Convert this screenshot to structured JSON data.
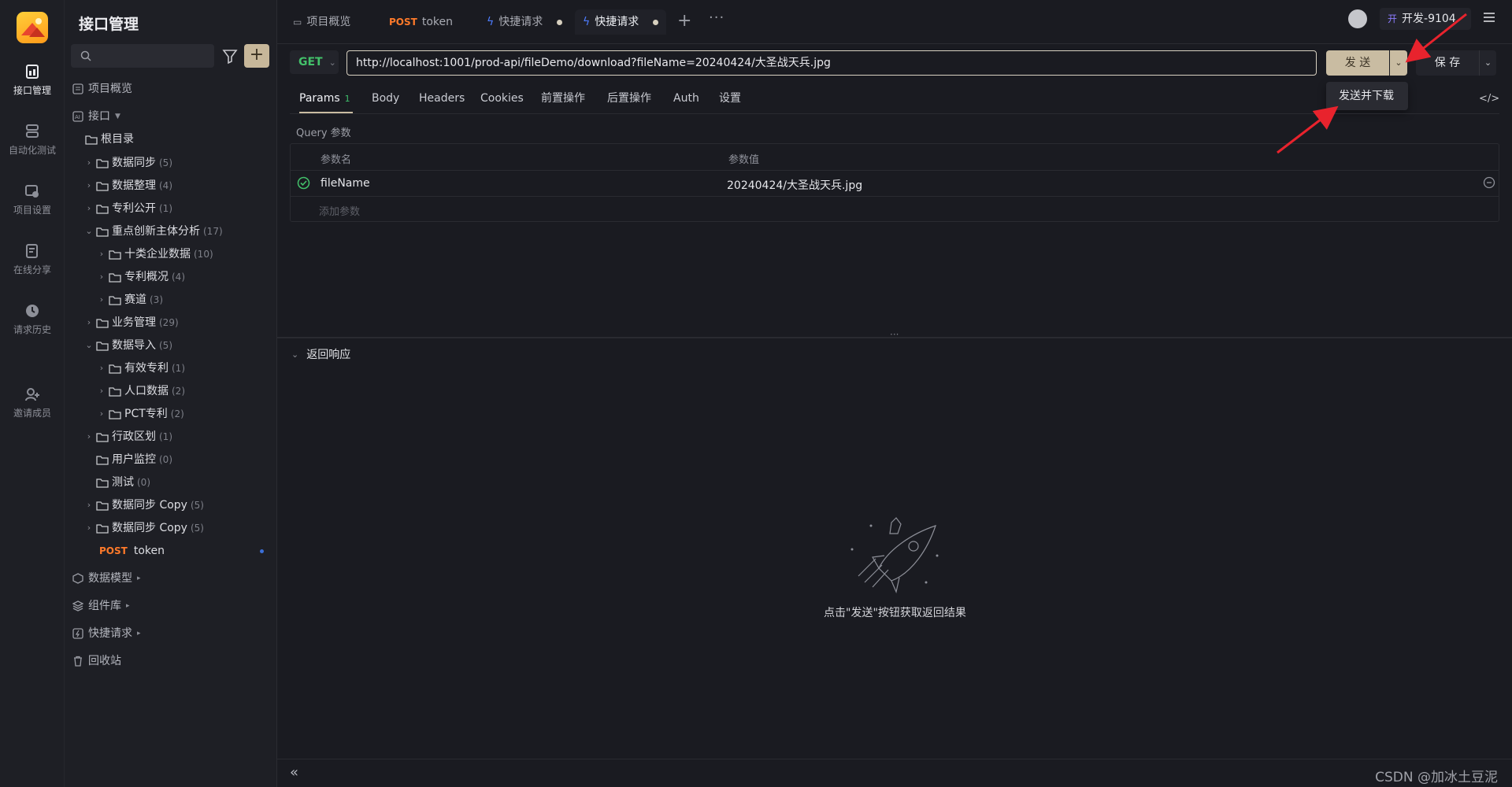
{
  "rail": {
    "items": [
      {
        "label": "接口管理",
        "icon": "api-manage-icon"
      },
      {
        "label": "自动化测试",
        "icon": "auto-test-icon"
      },
      {
        "label": "项目设置",
        "icon": "project-settings-icon"
      },
      {
        "label": "在线分享",
        "icon": "share-icon"
      },
      {
        "label": "请求历史",
        "icon": "history-icon"
      },
      {
        "label": "邀请成员",
        "icon": "invite-member-icon"
      }
    ]
  },
  "sidebar": {
    "title": "接口管理",
    "search_placeholder": "",
    "nav": {
      "overview": "项目概览",
      "api": "接口",
      "data_model": "数据模型",
      "components": "组件库",
      "quick_request": "快捷请求",
      "recycle": "回收站"
    },
    "tree": [
      {
        "label": "根目录",
        "count": ""
      },
      {
        "label": "数据同步",
        "count": "(5)"
      },
      {
        "label": "数据整理",
        "count": "(4)"
      },
      {
        "label": "专利公开",
        "count": "(1)"
      },
      {
        "label": "重点创新主体分析",
        "count": "(17)"
      },
      {
        "label": "十类企业数据",
        "count": "(10)"
      },
      {
        "label": "专利概况",
        "count": "(4)"
      },
      {
        "label": "赛道",
        "count": "(3)"
      },
      {
        "label": "业务管理",
        "count": "(29)"
      },
      {
        "label": "数据导入",
        "count": "(5)"
      },
      {
        "label": "有效专利",
        "count": "(1)"
      },
      {
        "label": "人口数据",
        "count": "(2)"
      },
      {
        "label": "PCT专利",
        "count": "(2)"
      },
      {
        "label": "行政区划",
        "count": "(1)"
      },
      {
        "label": "用户监控",
        "count": "(0)"
      },
      {
        "label": "测试",
        "count": "(0)"
      },
      {
        "label": "数据同步 Copy",
        "count": "(5)"
      },
      {
        "label": "数据同步 Copy",
        "count": "(5)"
      }
    ],
    "token_item": {
      "method": "POST",
      "label": "token"
    }
  },
  "tabs": [
    {
      "label": "项目概览",
      "method": ""
    },
    {
      "label": "token",
      "method": "POST"
    },
    {
      "label": "快捷请求",
      "method": ""
    },
    {
      "label": "快捷请求",
      "method": ""
    }
  ],
  "topbar": {
    "env_tag": "开",
    "env_name": "开发-9104"
  },
  "request": {
    "method": "GET",
    "url": "http://localhost:1001/prod-api/fileDemo/download?fileName=20240424/大圣战天兵.jpg",
    "send_label": "发 送",
    "save_label": "保 存",
    "dropdown_item": "发送并下载"
  },
  "subtabs": [
    {
      "label": "Params",
      "badge": "1"
    },
    {
      "label": "Body",
      "badge": ""
    },
    {
      "label": "Headers",
      "badge": ""
    },
    {
      "label": "Cookies",
      "badge": ""
    },
    {
      "label": "前置操作",
      "badge": ""
    },
    {
      "label": "后置操作",
      "badge": ""
    },
    {
      "label": "Auth",
      "badge": ""
    },
    {
      "label": "设置",
      "badge": ""
    }
  ],
  "params": {
    "section_label": "Query 参数",
    "header_name": "参数名",
    "header_value": "参数值",
    "rows": [
      {
        "name": "fileName",
        "value": "20240424/大圣战天兵.jpg"
      }
    ],
    "add_placeholder": "添加参数"
  },
  "response": {
    "title": "返回响应",
    "empty_text": "点击\"发送\"按钮获取返回结果"
  },
  "footer": {
    "watermark": "CSDN @加冰土豆泥"
  },
  "colors": {
    "accent": "#c9bca2",
    "get_method": "#43c16a",
    "post_method": "#ff7a2a",
    "annotation": "#e8232d"
  }
}
